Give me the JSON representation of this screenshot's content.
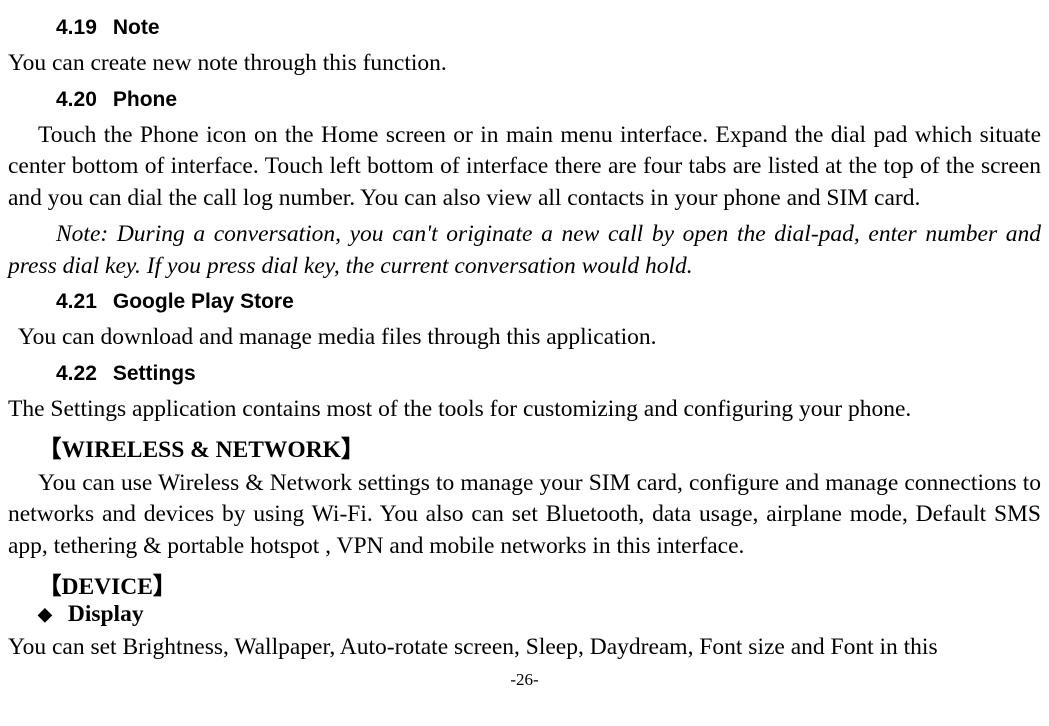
{
  "sections": {
    "s419": {
      "num": "4.19",
      "title": "Note"
    },
    "s420": {
      "num": "4.20",
      "title": "Phone"
    },
    "s421": {
      "num": "4.21",
      "title": "Google Play Store"
    },
    "s422": {
      "num": "4.22",
      "title": "Settings"
    }
  },
  "paragraphs": {
    "p419": "You can create new note through this function.",
    "p420": "Touch the Phone icon on the Home screen or in main menu interface. Expand the dial pad which situate center bottom of interface. Touch left bottom of interface there are four tabs are listed at the top of the screen and you can dial the call log number. You can also view all contacts in your phone and SIM card.",
    "note420": "Note: During a conversation, you can't originate a new call by open the dial-pad, enter number and press dial key. If you press dial key, the current conversation would hold.",
    "p421": "You can download and manage media files through this application.",
    "p422a": "The Settings application contains most of the tools for customizing and configuring your phone.",
    "wirelessHead": "【WIRELESS & NETWORK】",
    "p422b": "You can use Wireless & Network settings to manage your SIM card, configure and manage connections to networks and devices by using Wi-Fi. You also can set Bluetooth, data usage, airplane mode, Default SMS app, tethering & portable hotspot , VPN and mobile networks in this interface.",
    "deviceHead": "【DEVICE】",
    "displayBullet": "Display",
    "p422c": "You can set Brightness, Wallpaper, Auto-rotate screen, Sleep, Daydream, Font size and Font in this"
  },
  "pageNumber": "-26-"
}
